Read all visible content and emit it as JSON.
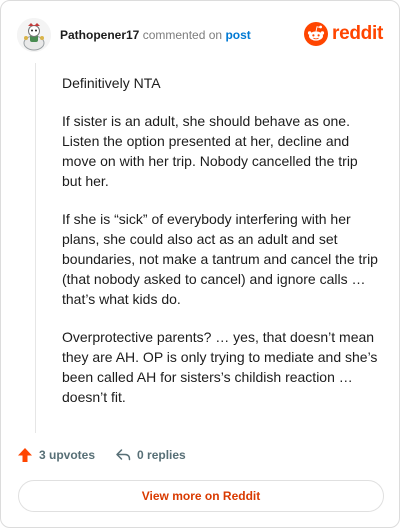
{
  "comment": {
    "username": "Pathopener17",
    "action_text": "commented on",
    "post_link": "post",
    "paragraphs": [
      "Definitively NTA",
      "If sister is an adult, she should behave as one. Listen the option presented at her, decline and move on with her trip. Nobody cancelled the trip but her.",
      "If she is “sick” of everybody interfering with her plans, she could also act as an adult and set boundaries, not make a tantrum and cancel the trip (that nobody asked to cancel) and ignore calls … that’s what kids do.",
      "Overprotective parents? … yes, that doesn’t mean they are AH. OP is only trying to mediate and she’s been called AH for sisters’s childish reaction … doesn’t fit."
    ]
  },
  "brand": {
    "name": "reddit",
    "color": "#ff4500",
    "icon": "reddit-snoo-icon"
  },
  "footer": {
    "upvotes": "3 upvotes",
    "replies": "0 replies",
    "upvote_icon": "upvote-arrow-icon",
    "reply_icon": "reply-arrow-icon",
    "upvote_color": "#ff4500"
  },
  "view_more": {
    "label": "View more on Reddit",
    "color": "#d93a00"
  }
}
